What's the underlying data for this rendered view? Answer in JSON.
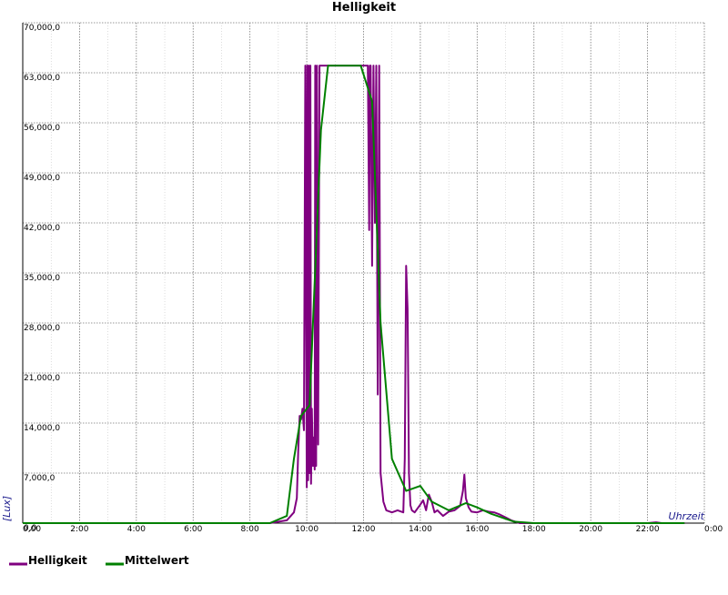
{
  "chart_data": {
    "type": "line",
    "title": "Helligkeit",
    "xlabel": "Uhrzeit",
    "ylabel": "[Lux]",
    "xlim": [
      0,
      24
    ],
    "ylim": [
      0,
      70000
    ],
    "grid": true,
    "legend_position": "bottom-left",
    "x_tick_labels": [
      "0,00",
      "2:00",
      "4:00",
      "6:00",
      "8:00",
      "10:00",
      "12:00",
      "14:00",
      "16:00",
      "18:00",
      "20:00",
      "22:00",
      "0:00"
    ],
    "y_tick_labels": [
      "0,0",
      "7,000,0",
      "14,000,0",
      "21,000,0",
      "28,000,0",
      "35,000,0",
      "42,000,0",
      "49,000,0",
      "56,000,0",
      "63,000,0",
      "70,000,0"
    ],
    "y_tick_values": [
      0,
      7000,
      14000,
      21000,
      28000,
      35000,
      42000,
      49000,
      56000,
      63000,
      70000
    ],
    "series": [
      {
        "name": "Helligkeit",
        "color": "#800080",
        "x": [
          0,
          8.7,
          9.3,
          9.55,
          9.65,
          9.7,
          9.75,
          9.8,
          9.85,
          9.9,
          9.95,
          10.0,
          10.02,
          10.05,
          10.07,
          10.1,
          10.13,
          10.15,
          10.18,
          10.22,
          10.25,
          10.28,
          10.3,
          10.33,
          10.36,
          10.4,
          10.45,
          10.5,
          10.55,
          10.6,
          10.65,
          10.7,
          11.0,
          11.5,
          12.0,
          12.1,
          12.15,
          12.2,
          12.22,
          12.25,
          12.3,
          12.35,
          12.4,
          12.45,
          12.5,
          12.55,
          12.6,
          12.7,
          12.8,
          13.0,
          13.2,
          13.4,
          13.45,
          13.5,
          13.55,
          13.6,
          13.65,
          13.7,
          13.8,
          14.0,
          14.1,
          14.2,
          14.3,
          14.4,
          14.5,
          14.6,
          14.8,
          15.0,
          15.2,
          15.4,
          15.5,
          15.55,
          15.6,
          15.7,
          15.8,
          16.0,
          16.2,
          16.4,
          16.6,
          16.8,
          17.0,
          17.2,
          17.5,
          18.0,
          20.0,
          22.0,
          22.3,
          22.5,
          23.0,
          23.3
        ],
        "values": [
          0,
          0,
          400,
          1500,
          3500,
          10000,
          15000,
          14500,
          16000,
          13000,
          64000,
          5000,
          64000,
          6000,
          64000,
          7000,
          64000,
          5500,
          16000,
          8000,
          12000,
          7500,
          64000,
          8000,
          64000,
          11000,
          64000,
          64000,
          64000,
          64000,
          64000,
          64000,
          64000,
          64000,
          64000,
          64000,
          64000,
          41000,
          64000,
          64000,
          36000,
          64000,
          42000,
          64000,
          18000,
          64000,
          7000,
          3000,
          1800,
          1500,
          1800,
          1500,
          9000,
          36000,
          30000,
          7000,
          2500,
          1800,
          1500,
          2600,
          3200,
          1800,
          4000,
          3000,
          1500,
          1800,
          1000,
          1600,
          1800,
          2400,
          4500,
          6800,
          3500,
          2200,
          1600,
          1500,
          1800,
          1600,
          1500,
          1200,
          800,
          400,
          0,
          0,
          0,
          0,
          120,
          0,
          0,
          0
        ]
      },
      {
        "name": "Mittelwert",
        "color": "#008000",
        "x": [
          0,
          8.7,
          9.3,
          9.55,
          9.8,
          10.1,
          10.5,
          10.75,
          11.0,
          11.5,
          11.9,
          12.3,
          12.6,
          13.0,
          13.5,
          14.0,
          14.4,
          15.0,
          15.6,
          16.0,
          16.5,
          17.3,
          18.0,
          20.0,
          22.0,
          23.3
        ],
        "values": [
          0,
          0,
          1000,
          9000,
          15000,
          16500,
          55000,
          64000,
          64000,
          64000,
          64000,
          59000,
          28000,
          9000,
          4500,
          5200,
          3000,
          1800,
          2800,
          2200,
          1300,
          200,
          0,
          0,
          0,
          0
        ]
      }
    ]
  }
}
